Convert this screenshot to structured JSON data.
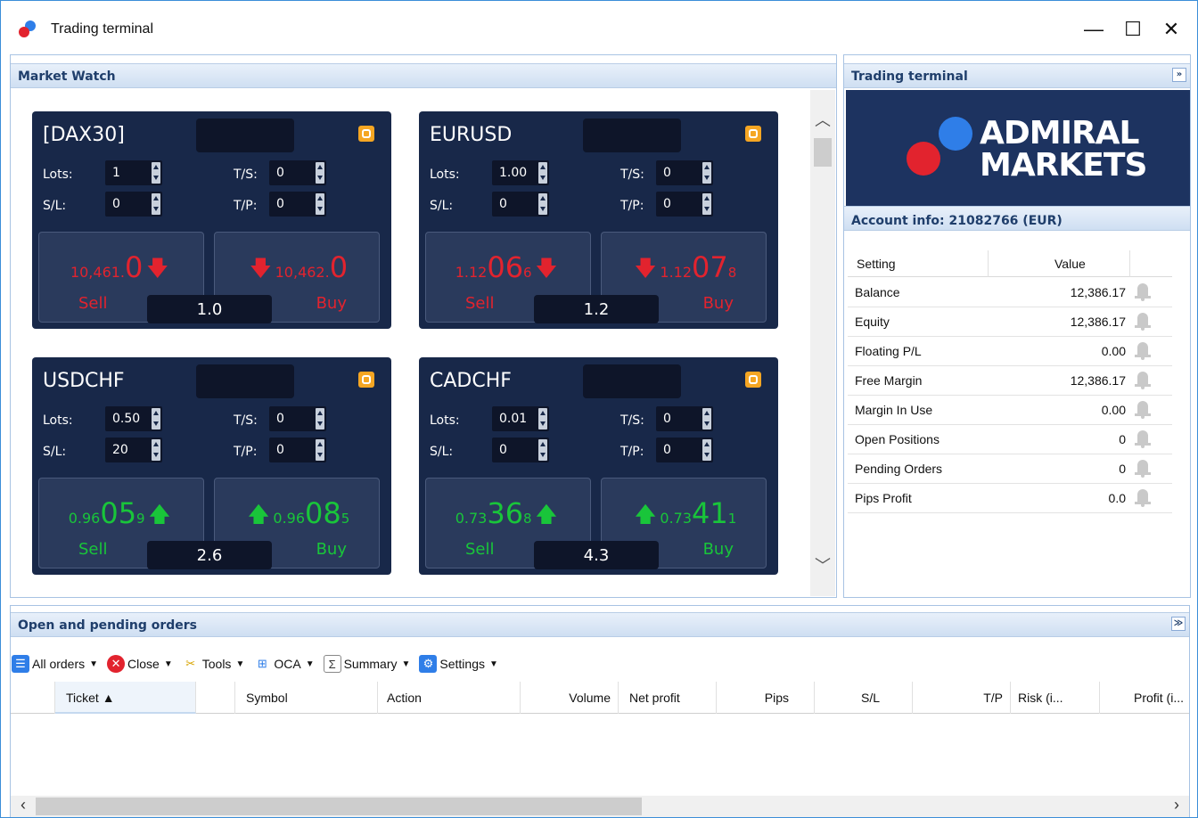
{
  "window": {
    "title": "Trading terminal",
    "controls": [
      "—",
      "☐",
      "✕"
    ]
  },
  "market_watch": {
    "title": "Market Watch",
    "tiles": [
      {
        "symbol": "[DAX30]",
        "lots": "1",
        "sl": "0",
        "ts": "0",
        "tp": "0",
        "sell": {
          "pre": "10,461.",
          "big": "0",
          "sup": ""
        },
        "buy": {
          "pre": "10,462.",
          "big": "0",
          "sup": ""
        },
        "spread": "1.0",
        "color": "red",
        "sell_label": "Sell",
        "buy_label": "Buy"
      },
      {
        "symbol": "EURUSD",
        "lots": "1.00",
        "sl": "0",
        "ts": "0",
        "tp": "0",
        "sell": {
          "pre": "1.12",
          "big": "06",
          "sup": "6"
        },
        "buy": {
          "pre": "1.12",
          "big": "07",
          "sup": "8"
        },
        "spread": "1.2",
        "color": "red",
        "sell_label": "Sell",
        "buy_label": "Buy"
      },
      {
        "symbol": "USDCHF",
        "lots": "0.50",
        "sl": "20",
        "ts": "0",
        "tp": "0",
        "sell": {
          "pre": "0.96",
          "big": "05",
          "sup": "9"
        },
        "buy": {
          "pre": "0.96",
          "big": "08",
          "sup": "5"
        },
        "spread": "2.6",
        "color": "green",
        "sell_label": "Sell",
        "buy_label": "Buy"
      },
      {
        "symbol": "CADCHF",
        "lots": "0.01",
        "sl": "0",
        "ts": "0",
        "tp": "0",
        "sell": {
          "pre": "0.73",
          "big": "36",
          "sup": "8"
        },
        "buy": {
          "pre": "0.73",
          "big": "41",
          "sup": "1"
        },
        "spread": "4.3",
        "color": "green",
        "sell_label": "Sell",
        "buy_label": "Buy"
      }
    ],
    "labels": {
      "lots": "Lots:",
      "sl": "S/L:",
      "ts": "T/S:",
      "tp": "T/P:"
    }
  },
  "terminal": {
    "title": "Trading terminal",
    "brand_line1": "ADMIRAL",
    "brand_line2": "MARKETS",
    "account_title": "Account info: 21082766 (EUR)",
    "columns": [
      "Setting",
      "Value"
    ],
    "rows": [
      {
        "k": "Balance",
        "v": "12,386.17"
      },
      {
        "k": "Equity",
        "v": "12,386.17"
      },
      {
        "k": "Floating P/L",
        "v": "0.00"
      },
      {
        "k": "Free Margin",
        "v": "12,386.17"
      },
      {
        "k": "Margin In Use",
        "v": "0.00"
      },
      {
        "k": "Open Positions",
        "v": "0"
      },
      {
        "k": "Pending Orders",
        "v": "0"
      },
      {
        "k": "Pips Profit",
        "v": "0.0"
      }
    ]
  },
  "orders": {
    "title": "Open and pending orders",
    "toolbar": [
      "All orders",
      "Close",
      "Tools",
      "OCA",
      "Summary",
      "Settings"
    ],
    "columns": [
      "Ticket ▲",
      "Symbol",
      "Action",
      "Volume",
      "Net profit",
      "Pips",
      "S/L",
      "T/P",
      "Risk (i...",
      "Profit (i..."
    ]
  },
  "colors": {
    "tile_bg": "#182849",
    "sell_red": "#e2232e",
    "buy_green": "#19c53a",
    "accent_blue": "#2f7ee8"
  }
}
